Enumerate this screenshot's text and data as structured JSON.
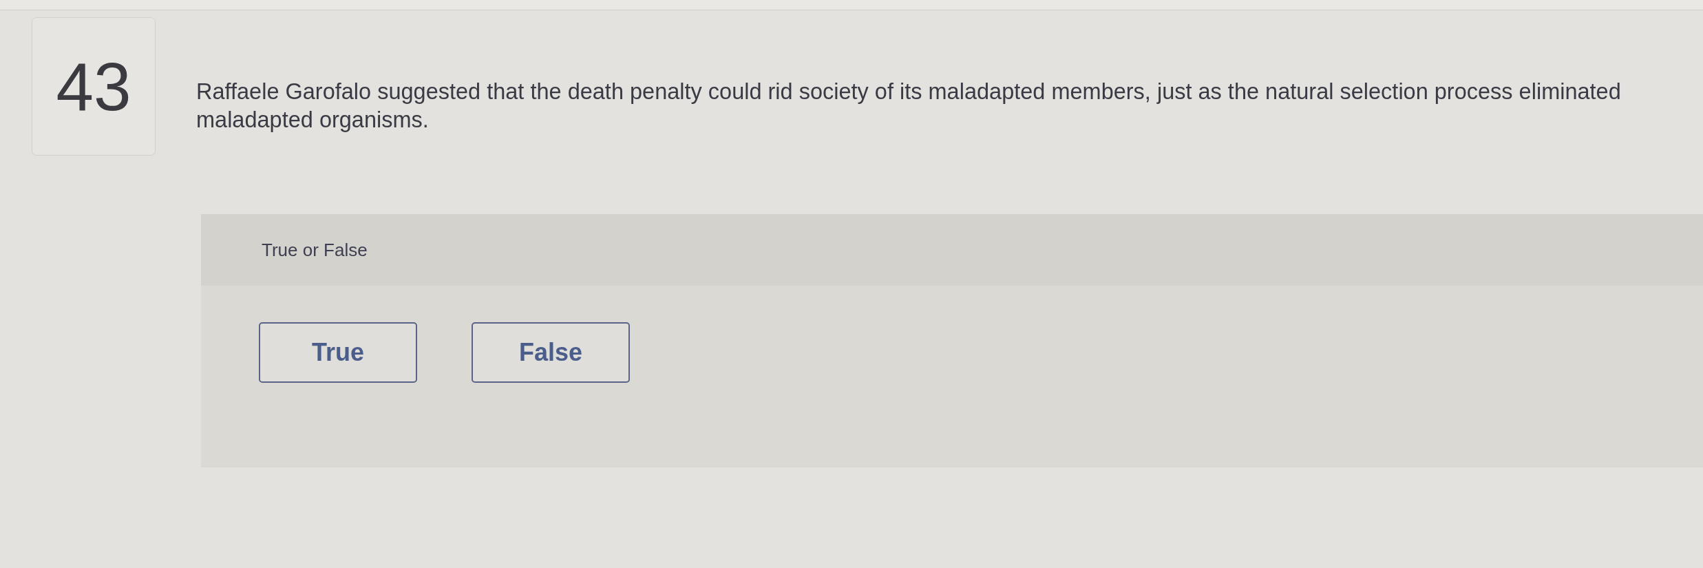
{
  "question": {
    "number": "43",
    "text": "Raffaele Garofalo suggested that the death penalty could rid society of its maladapted members, just as the natural selection process eliminated maladapted organisms."
  },
  "answer_panel": {
    "prompt": "True or False",
    "options": [
      {
        "label": "True",
        "selected": false
      },
      {
        "label": "False",
        "selected": false
      }
    ]
  }
}
